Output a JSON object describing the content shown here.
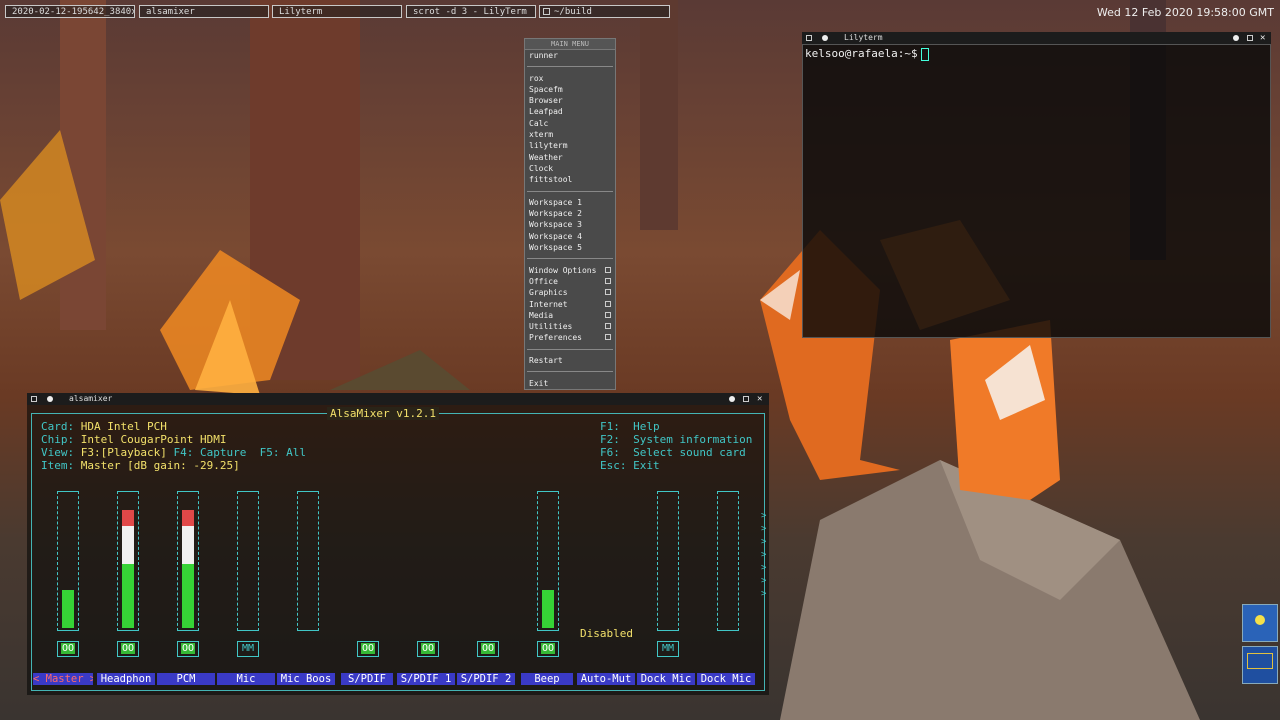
{
  "taskbar": {
    "buttons": [
      "2020-02-12-195642_3840x10",
      "alsamixer",
      "Lilyterm",
      "scrot -d 3 - LilyTerm",
      "~/build"
    ],
    "clock": "Wed 12 Feb 2020 19:58:00 GMT"
  },
  "menu": {
    "title": "MAIN MENU",
    "runner": "runner",
    "apps": [
      "rox",
      "Spacefm",
      "Browser",
      "Leafpad",
      "Calc",
      "xterm",
      "lilyterm",
      "Weather",
      "Clock",
      "fittstool"
    ],
    "workspaces": [
      "Workspace 1",
      "Workspace 2",
      "Workspace 3",
      "Workspace 4",
      "Workspace 5"
    ],
    "submenus": [
      "Window Options",
      "Office",
      "Graphics",
      "Internet",
      "Media",
      "Utilities",
      "Preferences"
    ],
    "restart": "Restart",
    "exit": "Exit"
  },
  "terminal": {
    "title": "Lilyterm",
    "prompt": "kelsoo@rafaela:~$"
  },
  "mixer": {
    "window_title": "alsamixer",
    "title": "AlsaMixer v1.2.1",
    "card_key": "Card:",
    "card": "HDA Intel PCH",
    "chip_key": "Chip:",
    "chip": "Intel CougarPoint HDMI",
    "view_key": "View:",
    "view_f3": "F3:[Playback]",
    "view_f4": "F4: Capture",
    "view_f5": "F5: All",
    "item_key": "Item:",
    "item": "Master [dB gain: -29.25]",
    "help": [
      {
        "key": "F1:",
        "text": "Help"
      },
      {
        "key": "F2:",
        "text": "System information"
      },
      {
        "key": "F6:",
        "text": "Select sound card"
      },
      {
        "key": "Esc:",
        "text": "Exit"
      }
    ],
    "disabled": "Disabled",
    "channels": [
      {
        "label": "Master",
        "level": "33",
        "switch": "OO",
        "green": 0.28,
        "white": 0,
        "red": 0
      },
      {
        "label": "Headphon",
        "level": "100<>100",
        "switch": "OO",
        "green": 0.47,
        "white": 0.28,
        "red": 0.12
      },
      {
        "label": "PCM",
        "level": "100<>100",
        "switch": "OO",
        "green": 0.47,
        "white": 0.28,
        "red": 0.12
      },
      {
        "label": "Mic",
        "level": "0<>0",
        "switch": "MM",
        "green": 0,
        "white": 0,
        "red": 0
      },
      {
        "label": "Mic Boos",
        "level": "0<>0",
        "switch": "",
        "green": 0,
        "white": 0,
        "red": 0
      },
      {
        "label": "S/PDIF",
        "level": "",
        "switch": "OO",
        "green": 0,
        "white": 0,
        "red": 0
      },
      {
        "label": "S/PDIF 1",
        "level": "",
        "switch": "OO",
        "green": 0,
        "white": 0,
        "red": 0
      },
      {
        "label": "S/PDIF 2",
        "level": "",
        "switch": "OO",
        "green": 0,
        "white": 0,
        "red": 0
      },
      {
        "label": "Beep",
        "level": "33",
        "switch": "OO",
        "green": 0.28,
        "white": 0,
        "red": 0
      },
      {
        "label": "Auto-Mut",
        "level": "",
        "switch": "",
        "green": 0,
        "white": 0,
        "red": 0
      },
      {
        "label": "Dock Mic",
        "level": "0<>0",
        "switch": "MM",
        "green": 0,
        "white": 0,
        "red": 0
      },
      {
        "label": "Dock Mic",
        "level": "0<>0",
        "switch": "",
        "green": 0,
        "white": 0,
        "red": 0
      }
    ]
  }
}
